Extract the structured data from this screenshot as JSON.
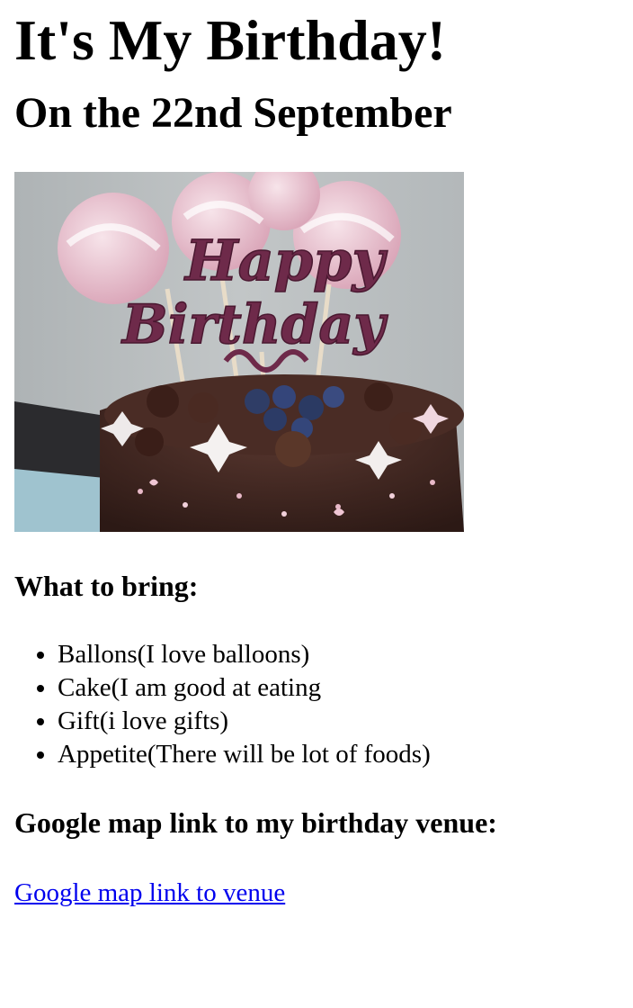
{
  "page": {
    "title": "It's My Birthday!",
    "subtitle": "On the 22nd September"
  },
  "image": {
    "topper_line1": "Happy",
    "topper_line2": "Birthday",
    "colors": {
      "background": "#b9bdbf",
      "cake": "#3e2621",
      "topper": "#6e2a4a",
      "meringue": "#e9c7d2"
    }
  },
  "bring": {
    "heading": "What to bring:",
    "items": [
      "Ballons(I love balloons)",
      "Cake(I am good at eating",
      "Gift(i love gifts)",
      "Appetite(There will be lot of foods)"
    ]
  },
  "map": {
    "heading": "Google map link to my birthday venue:",
    "link_text": "Google map link to venue",
    "link_color": "#0000ee"
  }
}
